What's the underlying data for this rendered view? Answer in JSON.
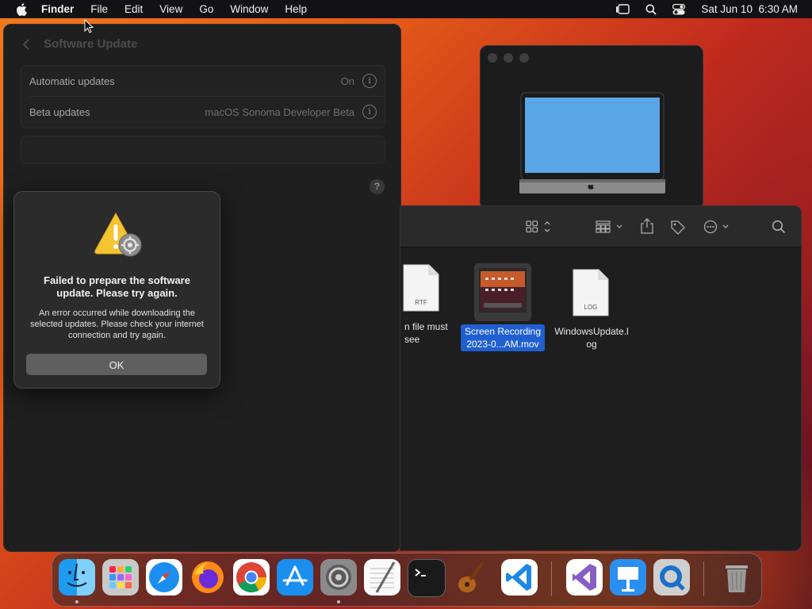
{
  "menubar": {
    "app": "Finder",
    "items": [
      "File",
      "Edit",
      "View",
      "Go",
      "Window",
      "Help"
    ],
    "datetime": "Sat Jun 10  6:30 AM"
  },
  "software_update": {
    "title": "Software Update",
    "rows": [
      {
        "label": "Automatic updates",
        "value": "On"
      },
      {
        "label": "Beta updates",
        "value": "macOS Sonoma Developer Beta"
      }
    ]
  },
  "alert": {
    "title": "Failed to prepare the software update. Please try again.",
    "message": "An error occurred while downloading the selected updates. Please check your internet connection and try again.",
    "ok_label": "OK"
  },
  "finder": {
    "files": [
      {
        "name": "n file must see",
        "badge": "RTF",
        "selected": false
      },
      {
        "name": "Screen Recording 2023-0...AM.mov",
        "badge": "",
        "selected": true
      },
      {
        "name": "WindowsUpdate.log",
        "badge": "LOG",
        "selected": false
      }
    ]
  },
  "dock": {
    "apps": [
      "Finder",
      "Launchpad",
      "Safari",
      "Firefox",
      "Chrome",
      "App Store",
      "System Settings",
      "TextEdit",
      "Terminal",
      "GarageBand",
      "Visual Studio Code",
      "Visual Studio",
      "Keynote",
      "QuickTime Player",
      "Trash"
    ]
  },
  "colors": {
    "selection": "#1f5fd0",
    "wallpaper_orange": "#e35718",
    "wallpaper_red": "#c02a1e"
  }
}
